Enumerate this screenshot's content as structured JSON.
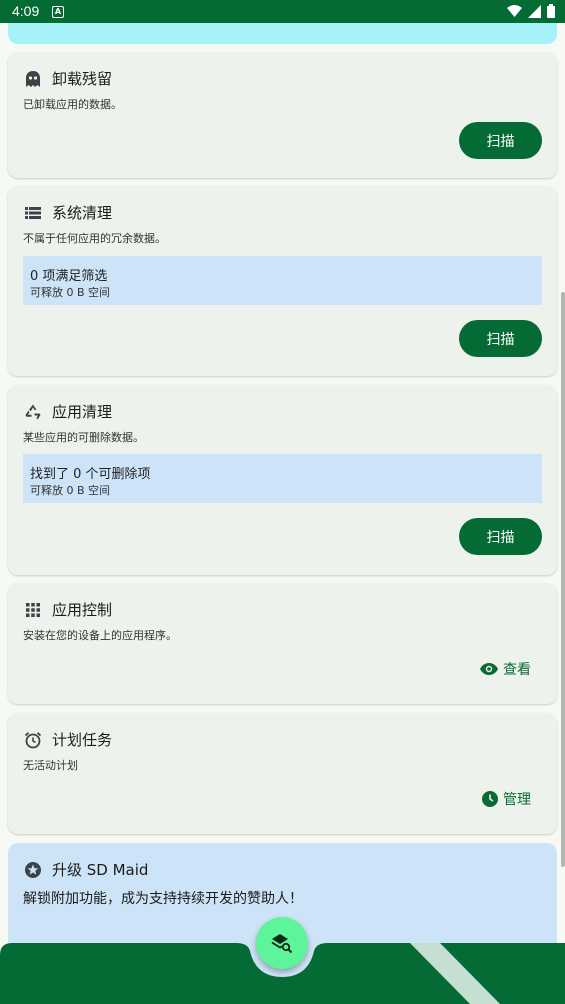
{
  "status_bar": {
    "time": "4:09",
    "notification_glyph": "A"
  },
  "cards": {
    "uninstall": {
      "title": "卸载残留",
      "subtitle": "已卸载应用的数据。",
      "button": "扫描",
      "icon": "ghost-icon"
    },
    "system": {
      "title": "系统清理",
      "subtitle": "不属于任何应用的冗余数据。",
      "info_main": "0 项满足筛选",
      "info_sub": "可释放 0 B 空间",
      "button": "扫描",
      "icon": "list-icon"
    },
    "app_cleaner": {
      "title": "应用清理",
      "subtitle": "某些应用的可删除数据。",
      "info_main": "找到了 0 个可删除项",
      "info_sub": "可释放 0 B 空间",
      "button": "扫描",
      "icon": "recycle-icon"
    },
    "app_control": {
      "title": "应用控制",
      "subtitle": "安装在您的设备上的应用程序。",
      "button": "查看",
      "icon": "grid-icon"
    },
    "scheduler": {
      "title": "计划任务",
      "subtitle": "无活动计划",
      "button": "管理",
      "icon": "alarm-clock-icon"
    },
    "upgrade": {
      "title": "升级 SD Maid",
      "description": "解锁附加功能，成为支持持续开发的赞助人！",
      "icon": "star-badge-icon"
    }
  },
  "colors": {
    "primary": "#056b35",
    "card": "#edf3ec",
    "info": "#cde3f7",
    "fab": "#5ef59a",
    "cyan": "#a7f2f9"
  }
}
